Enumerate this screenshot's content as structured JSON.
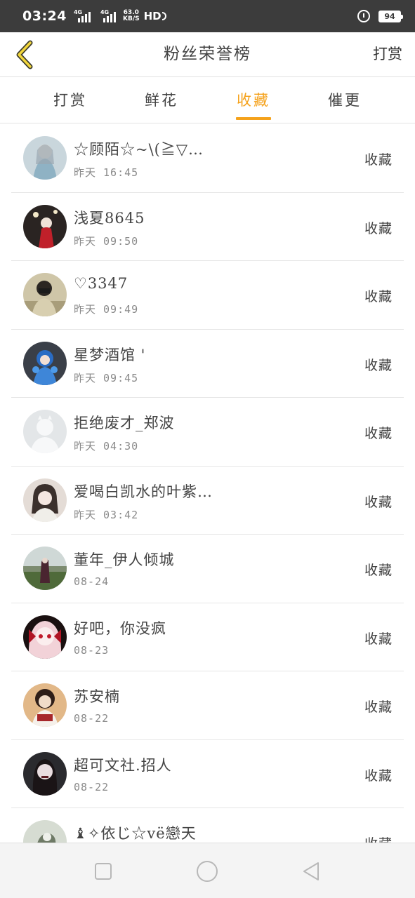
{
  "status_bar": {
    "time": "03:24",
    "net1": "4G",
    "net2": "4G",
    "speed_value": "63.0",
    "speed_unit": "KB/S",
    "hd": "HD",
    "battery": "94"
  },
  "header": {
    "title": "粉丝荣誉榜",
    "action": "打赏"
  },
  "tabs": [
    {
      "label": "打赏",
      "active": false
    },
    {
      "label": "鲜花",
      "active": false
    },
    {
      "label": "收藏",
      "active": true
    },
    {
      "label": "催更",
      "active": false
    }
  ],
  "accent_color": "#f5a21b",
  "fans": [
    {
      "name": "☆顾陌☆~\\(≧▽…",
      "time": "昨天 16:45",
      "type": "收藏"
    },
    {
      "name": "浅夏8645",
      "time": "昨天 09:50",
      "type": "收藏"
    },
    {
      "name": "♡3347",
      "time": "昨天 09:49",
      "type": "收藏"
    },
    {
      "name": "星梦酒馆 '",
      "time": "昨天 09:45",
      "type": "收藏"
    },
    {
      "name": "拒绝废才_郑波",
      "time": "昨天 04:30",
      "type": "收藏"
    },
    {
      "name": "爱喝白凯水的叶紫…",
      "time": "昨天 03:42",
      "type": "收藏"
    },
    {
      "name": "董年_伊人倾城",
      "time": "08-24",
      "type": "收藏"
    },
    {
      "name": "好吧，你没疯",
      "time": "08-23",
      "type": "收藏"
    },
    {
      "name": "苏安楠",
      "time": "08-22",
      "type": "收藏"
    },
    {
      "name": "超可文社.招人",
      "time": "08-22",
      "type": "收藏"
    },
    {
      "name": "♝✧依じ☆vё戀天",
      "time": "",
      "type": "收藏"
    }
  ],
  "icons": {
    "back": "chevron-left-icon",
    "recents": "square-icon",
    "home": "circle-icon",
    "nav_back": "triangle-left-icon"
  }
}
